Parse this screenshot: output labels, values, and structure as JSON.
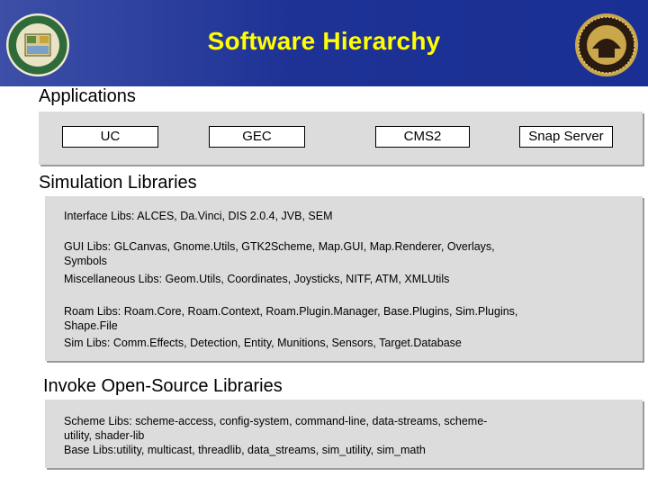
{
  "title": "Software Hierarchy",
  "sections": {
    "applications": {
      "heading": "Applications",
      "items": [
        "UC",
        "GEC",
        "CMS2",
        "Snap Server"
      ]
    },
    "simulation": {
      "heading": "Simulation Libraries",
      "lines": {
        "interface": "Interface Libs:  ALCES, Da.Vinci, DIS 2.0.4, JVB, SEM",
        "gui_1": "GUI Libs:  GLCanvas, Gnome.Utils, GTK2Scheme, Map.GUI, Map.Renderer, Overlays,",
        "gui_2": "Symbols",
        "misc": "Miscellaneous Libs:  Geom.Utils, Coordinates, Joysticks, NITF, ATM, XMLUtils",
        "roam_1": "Roam Libs:  Roam.Core, Roam.Context, Roam.Plugin.Manager, Base.Plugins, Sim.Plugins,",
        "roam_2": "Shape.File",
        "sim": "Sim Libs:  Comm.Effects, Detection, Entity, Munitions, Sensors, Target.Database"
      }
    },
    "open_source": {
      "heading": "Invoke Open-Source Libraries",
      "lines": {
        "scheme_1": "Scheme Libs:  scheme-access, config-system, command-line, data-streams, scheme-",
        "scheme_2": "utility, shader-lib",
        "base": "Base Libs:utility, multicast, threadlib, data_streams, sim_utility, sim_math"
      }
    }
  },
  "colors": {
    "header_bg": "#1e3296",
    "title": "#ffff00",
    "panel_bg": "#dcdcdc"
  }
}
